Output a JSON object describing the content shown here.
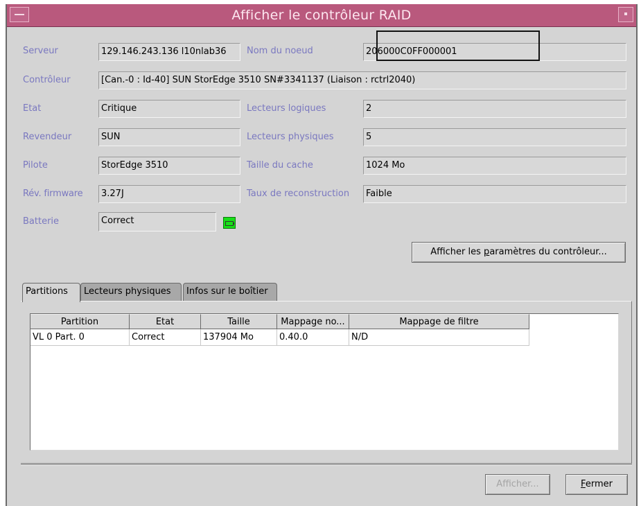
{
  "window": {
    "title": "Afficher le contrôleur RAID"
  },
  "fields": {
    "serveur": {
      "label": "Serveur",
      "value": "129.146.243.136 l10nlab36"
    },
    "nom_noeud": {
      "label": "Nom du noeud",
      "value": "206000C0FF000001"
    },
    "controleur": {
      "label": "Contrôleur",
      "value": "[Can.-0 : Id-40] SUN StorEdge 3510 SN#3341137  (Liaison : rctrl2040)"
    },
    "etat": {
      "label": "Etat",
      "value": "Critique"
    },
    "lecteurs_logiques": {
      "label": "Lecteurs logiques",
      "value": "2"
    },
    "revendeur": {
      "label": "Revendeur",
      "value": "SUN"
    },
    "lecteurs_physiques": {
      "label": "Lecteurs physiques",
      "value": "5"
    },
    "pilote": {
      "label": "Pilote",
      "value": "StorEdge 3510"
    },
    "taille_cache": {
      "label": "Taille du cache",
      "value": "1024 Mo"
    },
    "rev_firmware": {
      "label": "Rév. firmware",
      "value": "3.27J"
    },
    "taux_reconstruction": {
      "label": "Taux de reconstruction",
      "value": "Faible"
    },
    "batterie": {
      "label": "Batterie",
      "value": "Correct"
    }
  },
  "buttons": {
    "params_pre": "Afficher les ",
    "params_mn": "p",
    "params_post": "aramètres du contrôleur...",
    "afficher": "Afficher...",
    "fermer_mn": "F",
    "fermer_post": "ermer"
  },
  "tabs": [
    "Partitions",
    "Lecteurs physiques",
    "Infos sur le boîtier"
  ],
  "table": {
    "columns": [
      "Partition",
      "Etat",
      "Taille",
      "Mappage no...",
      "Mappage de filtre"
    ],
    "rows": [
      [
        "VL 0 Part. 0",
        "Correct",
        "137904 Mo",
        "0.40.0",
        "N/D"
      ]
    ]
  },
  "icons": {
    "battery": "battery-icon"
  },
  "colors": {
    "titlebar": "#b9597d",
    "label": "#7a78c0",
    "battery": "#18e018"
  }
}
